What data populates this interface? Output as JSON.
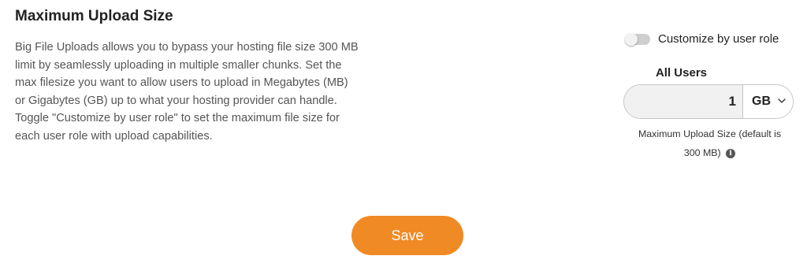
{
  "section": {
    "title": "Maximum Upload Size",
    "description_lines": [
      "Big File Uploads allows you to bypass your hosting file size 300 MB",
      "limit by seamlessly uploading in multiple smaller chunks. Set the",
      "max filesize you want to allow users to upload in Megabytes (MB)",
      "or Gigabytes (GB) up to what your hosting provider can handle.",
      "Toggle \"Customize by user role\" to set the maximum file size for",
      "each user role with upload capabilities."
    ]
  },
  "role_toggle": {
    "label": "Customize by user role",
    "enabled": false
  },
  "all_users": {
    "label": "All Users",
    "size_value": "1",
    "unit": "GB",
    "help_line1": "Maximum Upload Size (default is",
    "help_line2": "300 MB)",
    "info_icon_glyph": "i"
  },
  "actions": {
    "save_label": "Save"
  },
  "colors": {
    "accent": "#f08a24",
    "toggle_off": "#cfcfcf"
  }
}
